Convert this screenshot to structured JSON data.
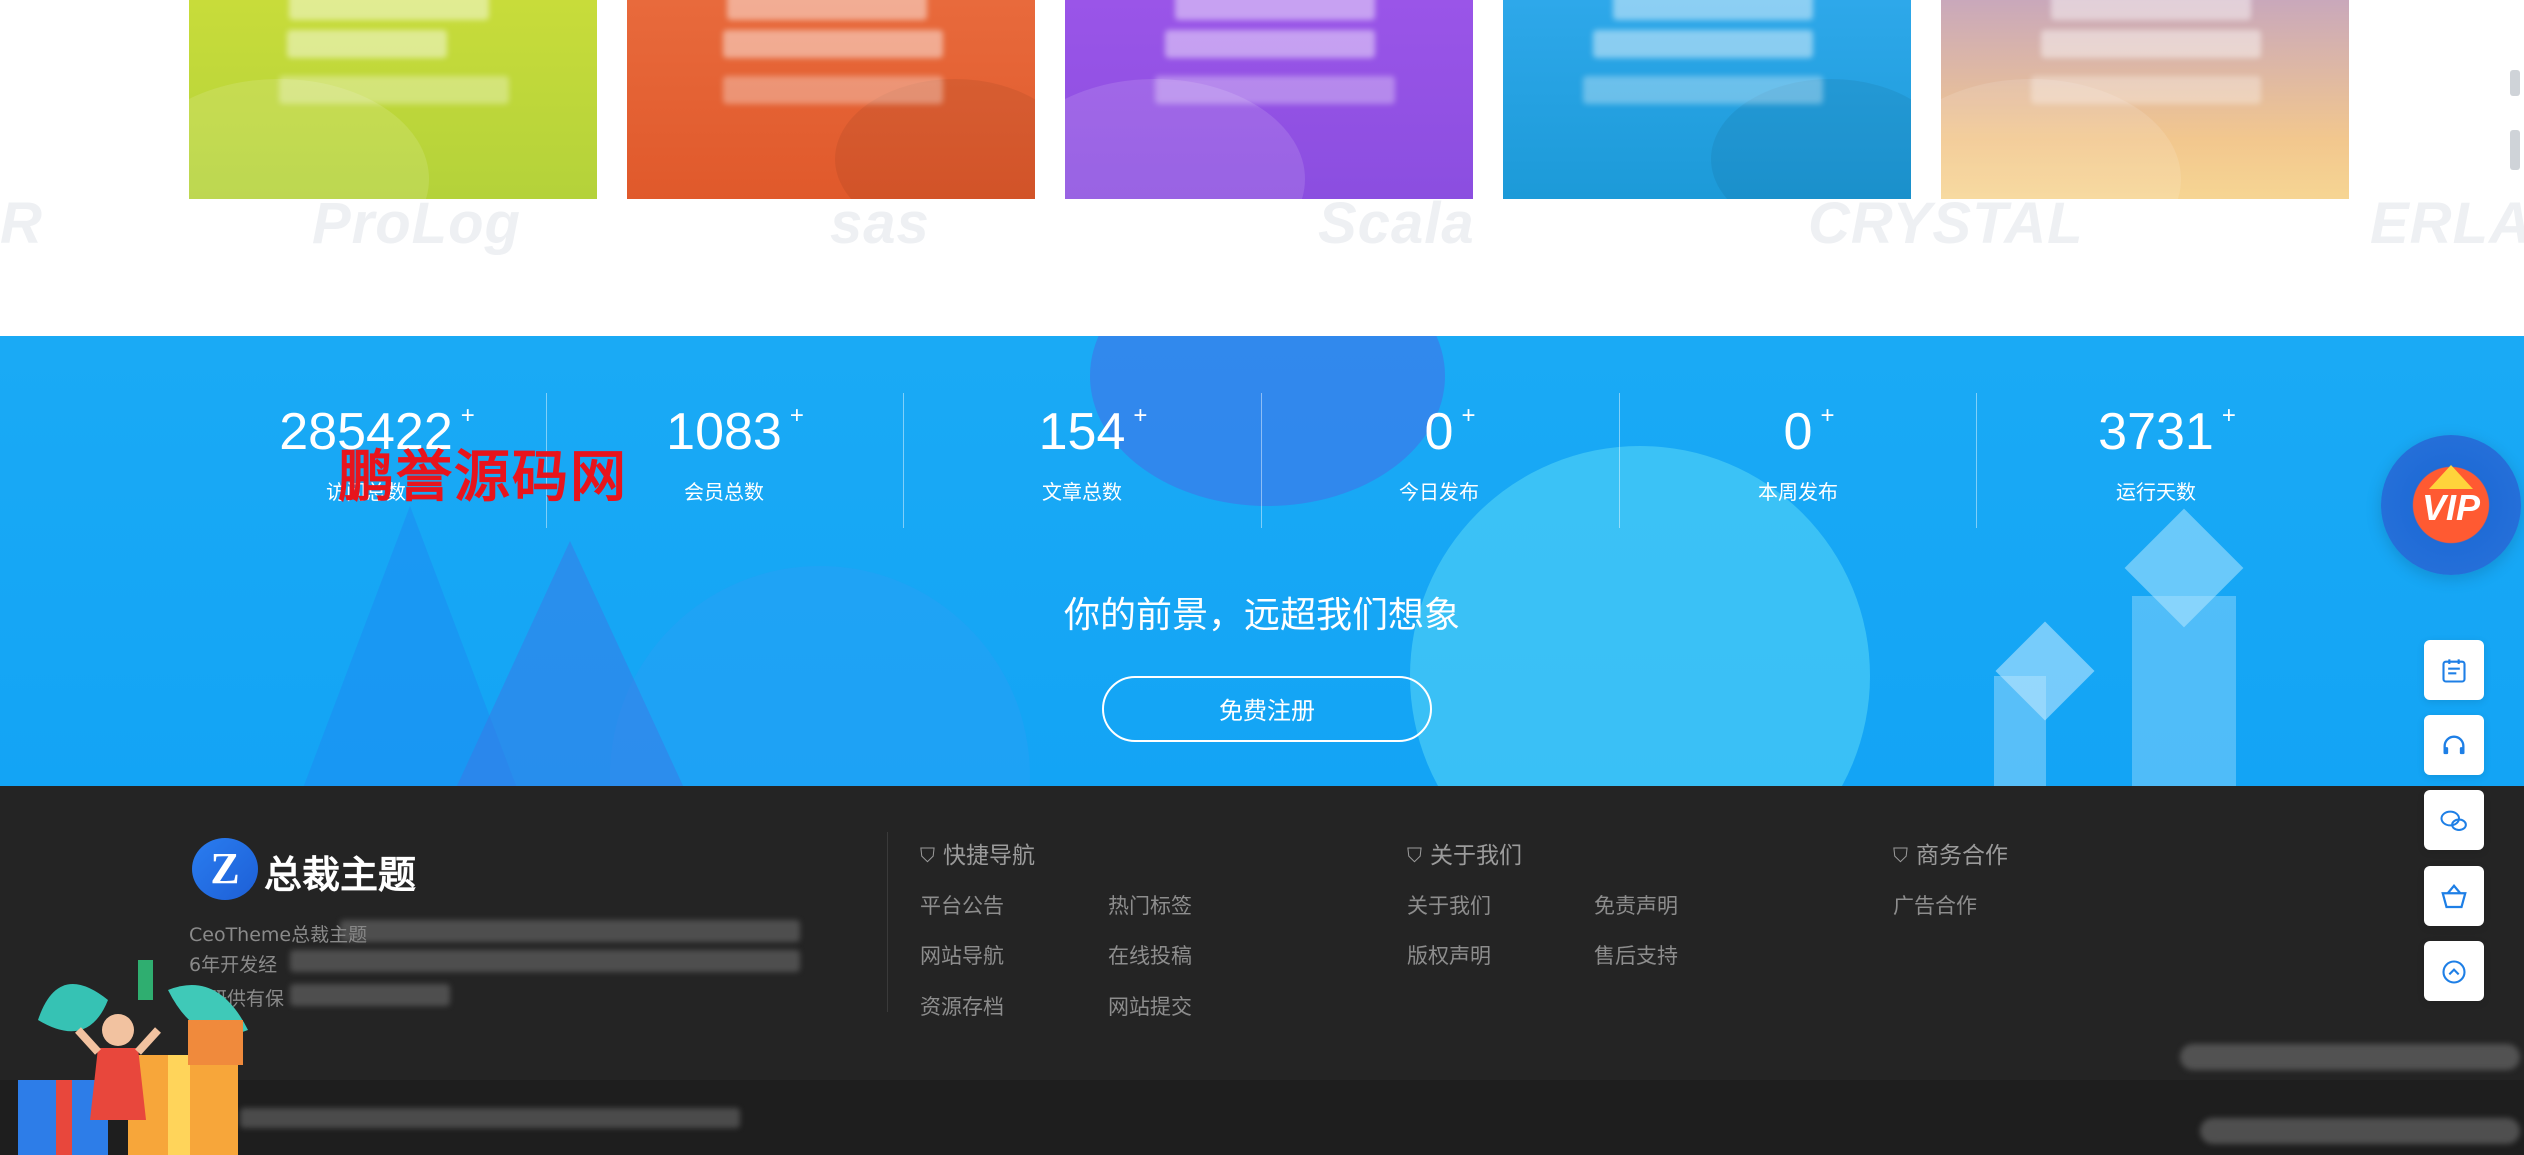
{
  "brands": [
    "R",
    "ProLog",
    "sas",
    "Scala",
    "CRYSTAL",
    "ERLAN"
  ],
  "stats": [
    {
      "value": "285422",
      "label": "访问总数"
    },
    {
      "value": "1083",
      "label": "会员总数"
    },
    {
      "value": "154",
      "label": "文章总数"
    },
    {
      "value": "0",
      "label": "今日发布"
    },
    {
      "value": "0",
      "label": "本周发布"
    },
    {
      "value": "3731",
      "label": "运行天数"
    }
  ],
  "stat_suffix": "+",
  "watermark": "鹏誉源码网",
  "slogan": "你的前景，远超我们想象",
  "register_button": "免费注册",
  "footer": {
    "logo_mark": "Z",
    "logo_text": "总裁主题",
    "intro_lines": [
      "CeoTheme总裁主题",
      "6年开发经",
      "开研供有保"
    ],
    "columns": [
      {
        "heading": "快捷导航",
        "links": [
          "平台公告",
          "热门标签",
          "网站导航",
          "在线投稿",
          "资源存档",
          "网站提交"
        ]
      },
      {
        "heading": "关于我们",
        "links": [
          "关于我们",
          "免责声明",
          "版权声明",
          "售后支持"
        ]
      },
      {
        "heading": "商务合作",
        "links": [
          "广告合作"
        ]
      }
    ]
  },
  "sidebar": {
    "vip": "VIP",
    "buttons": [
      "calendar-icon",
      "headset-icon",
      "wechat-icon",
      "basket-icon",
      "back-to-top-icon"
    ]
  },
  "colors": {
    "card1": "#c8dc3a",
    "card2": "#e86a3c",
    "card3": "#9a55e8",
    "card4": "#2ea8ea",
    "card5": "#f2c78e",
    "stats_bg": "#13a4f5",
    "footer_bg": "#242424",
    "watermark": "#e8141c"
  }
}
